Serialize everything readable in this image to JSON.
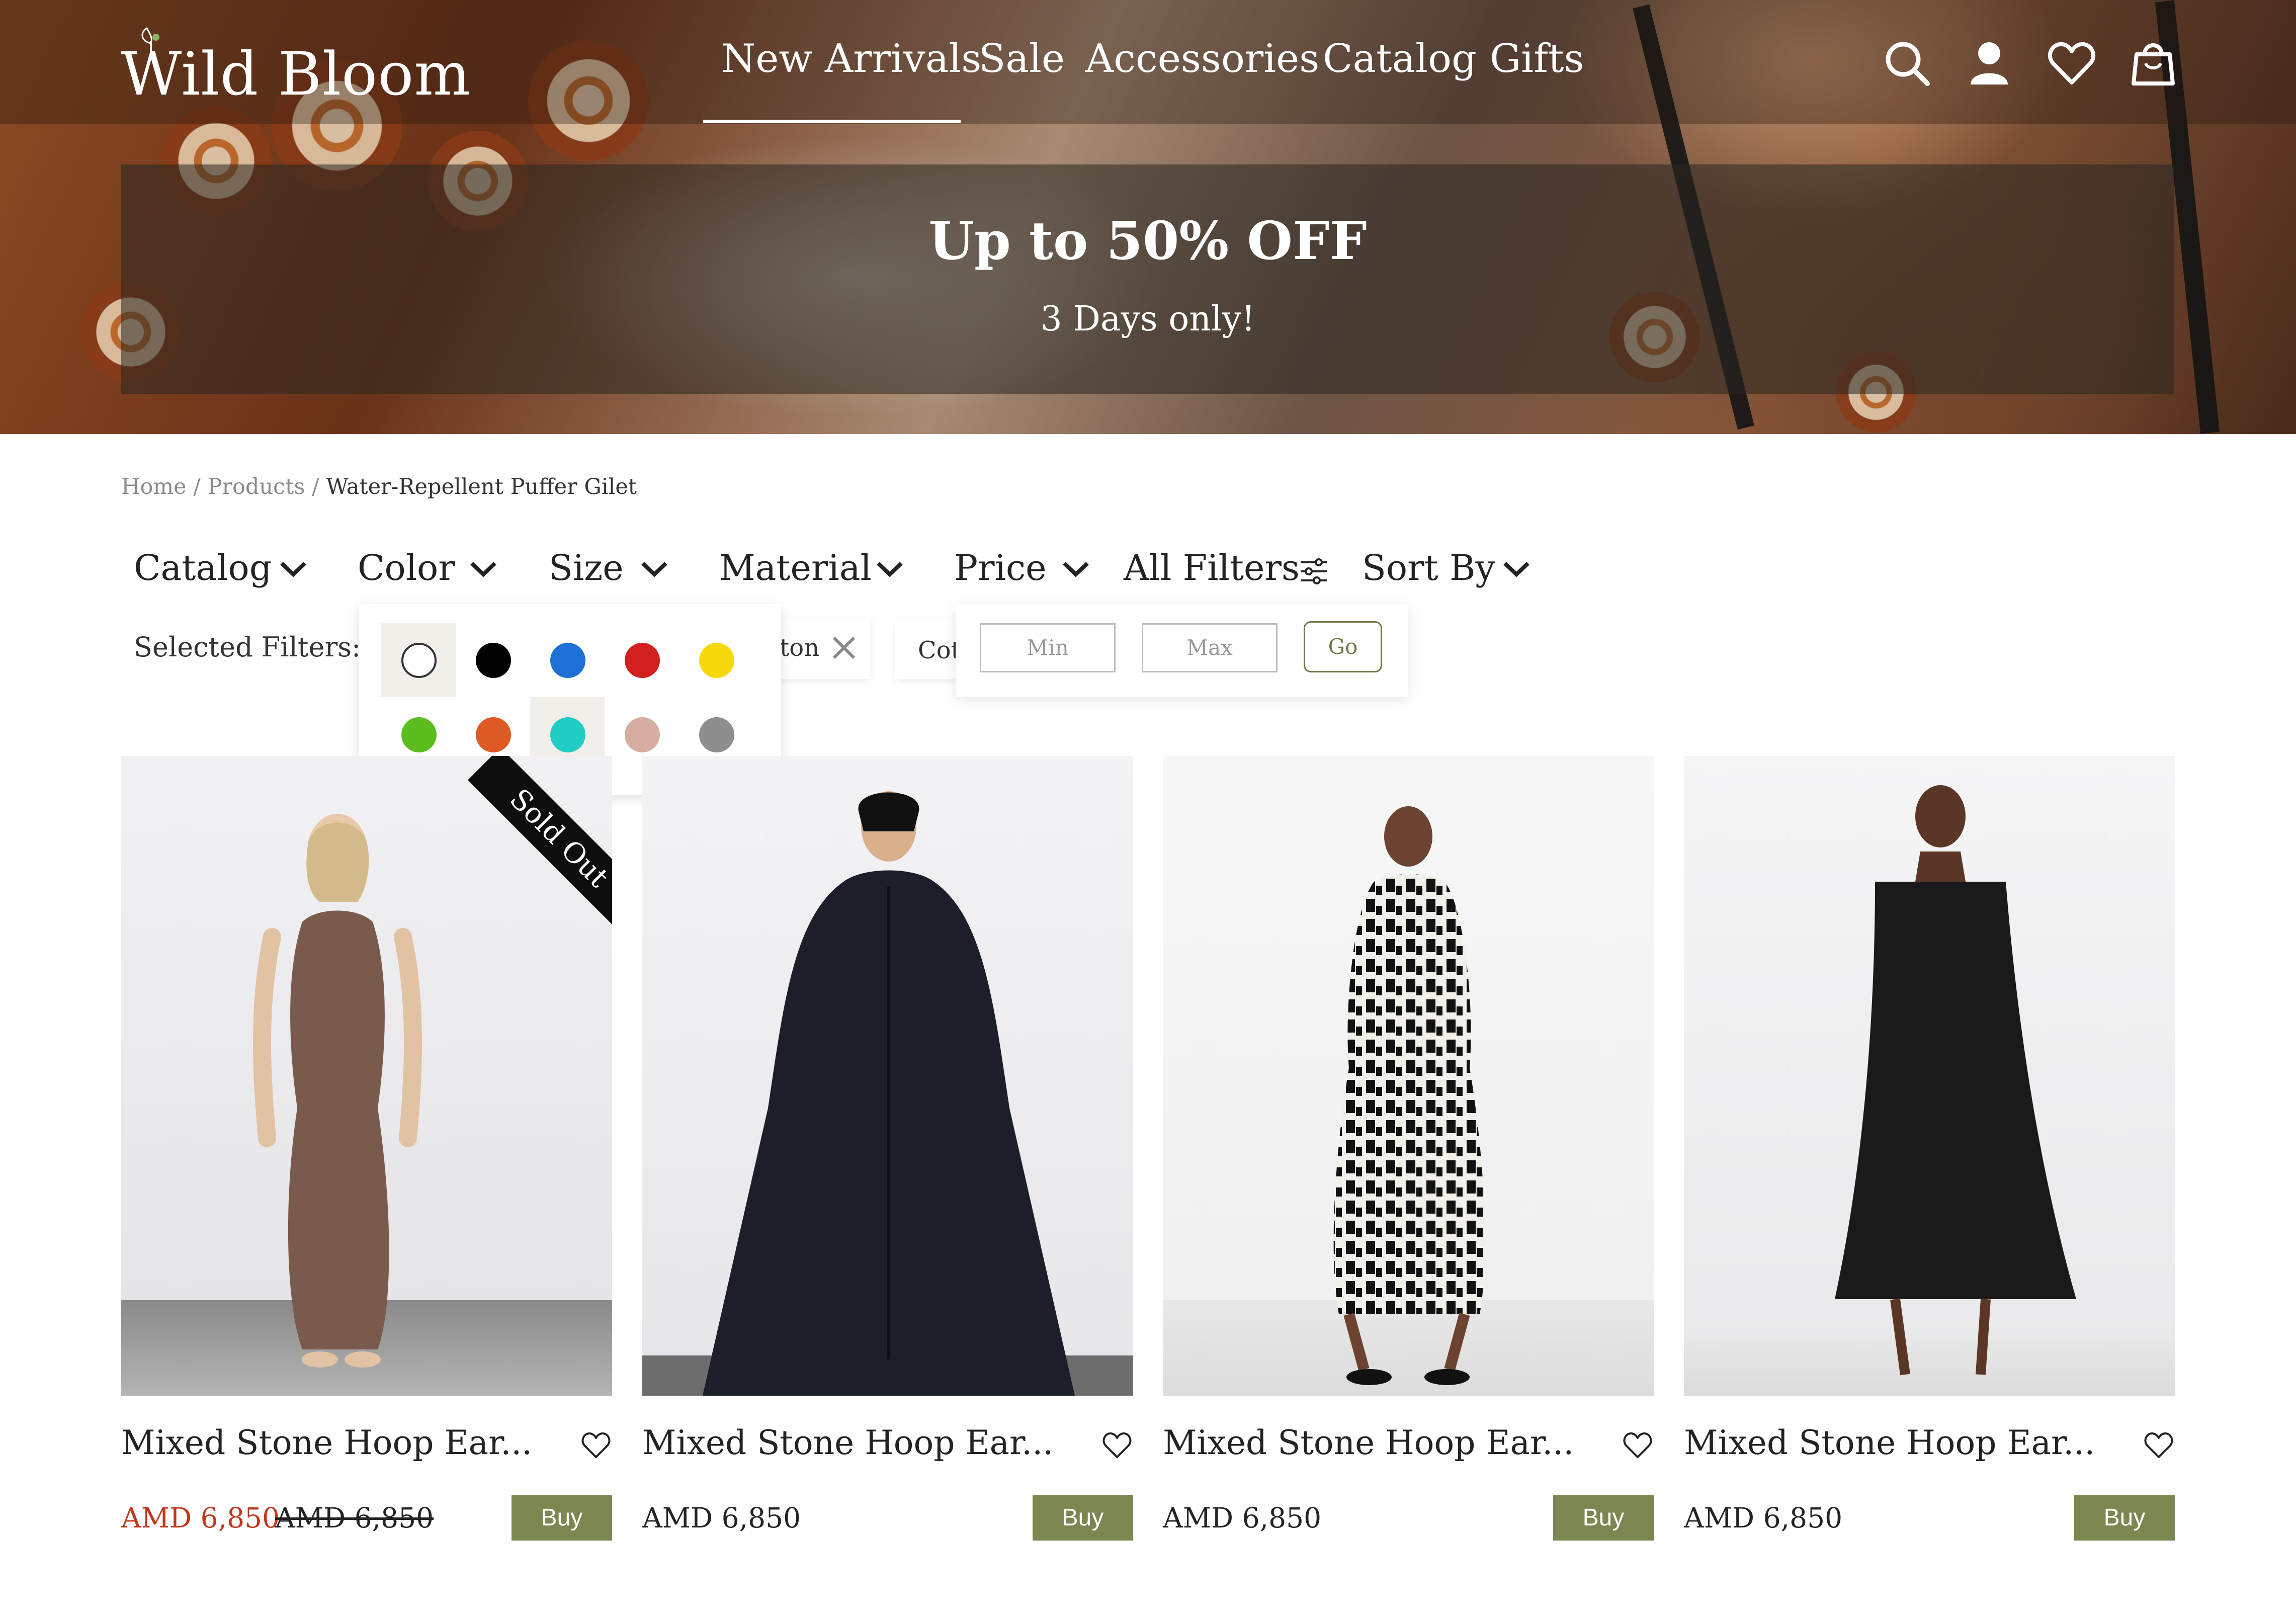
{
  "brand": {
    "name": "Wild Bloom"
  },
  "nav": {
    "items": [
      "New Arrivals",
      "Sale",
      "Accessories",
      "Catalog",
      "Gifts"
    ],
    "active": "New Arrivals"
  },
  "header_icons": [
    "search-icon",
    "user-icon",
    "heart-icon",
    "bag-icon"
  ],
  "promo": {
    "title": "Up to  50% OFF",
    "subtitle": "3 Days only!"
  },
  "breadcrumb": {
    "home": "Home",
    "products": "Products",
    "current": "Water-Repellent Puffer Gilet",
    "separator": "/"
  },
  "filters": {
    "items": [
      "Catalog",
      "Color",
      "Size",
      "Material",
      "Price",
      "All Filters",
      "Sort By"
    ],
    "selected_label": "Selected Filters:",
    "chips": [
      "ton",
      "Cot"
    ],
    "price_min_placeholder": "Min",
    "price_max_placeholder": "Max",
    "go_label": "Go"
  },
  "color_options": [
    "#ffffff",
    "#000000",
    "#1e6fd6",
    "#d21f1f",
    "#f5d90a",
    "#5cbd1e",
    "#dd5a22",
    "#22cdc6",
    "#d7ada1",
    "#8e8e8e"
  ],
  "colors": {
    "accent": "#7a8750",
    "sale": "#c0381c"
  },
  "products": [
    {
      "title": "Mixed Stone Hoop Ear...",
      "price": "AMD 6,850",
      "old_price": "AMD 6,850",
      "badge": "Sold Out",
      "buy": "Buy"
    },
    {
      "title": "Mixed Stone Hoop Ear...",
      "price": "AMD 6,850",
      "buy": "Buy"
    },
    {
      "title": "Mixed Stone Hoop Ear...",
      "price": "AMD 6,850",
      "buy": "Buy"
    },
    {
      "title": "Mixed Stone Hoop Ear...",
      "price": "AMD 6,850",
      "buy": "Buy"
    }
  ]
}
